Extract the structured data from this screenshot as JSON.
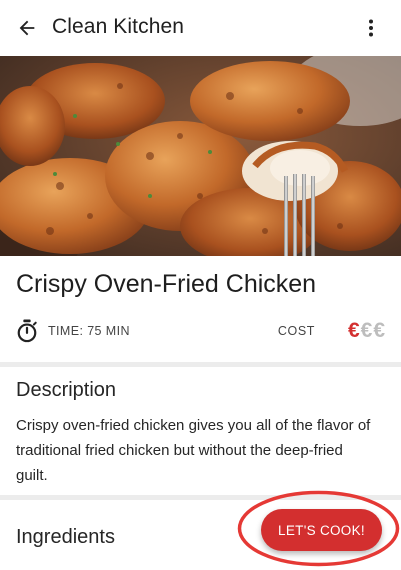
{
  "appbar": {
    "title": "Clean Kitchen",
    "back_icon": "arrow-left-icon",
    "menu_icon": "more-vert-icon"
  },
  "hero": {
    "image_alt": "Crispy oven-fried chicken pieces with a fork"
  },
  "recipe": {
    "title": "Crispy Oven-Fried Chicken",
    "time_label": "TIME: 75 MIN",
    "cost_label": "COST",
    "cost_symbol": "€",
    "cost_level": 1,
    "cost_max": 3
  },
  "description": {
    "heading": "Description",
    "text": "Crispy oven-fried chicken gives you all of the flavor of traditional fried chicken but without the deep-fried guilt."
  },
  "ingredients": {
    "heading": "Ingredients"
  },
  "fab": {
    "label": "LET'S COOK!"
  },
  "colors": {
    "accent": "#d32f2f",
    "inactive": "#bdbdbd",
    "annotation_ring": "#e53935"
  }
}
